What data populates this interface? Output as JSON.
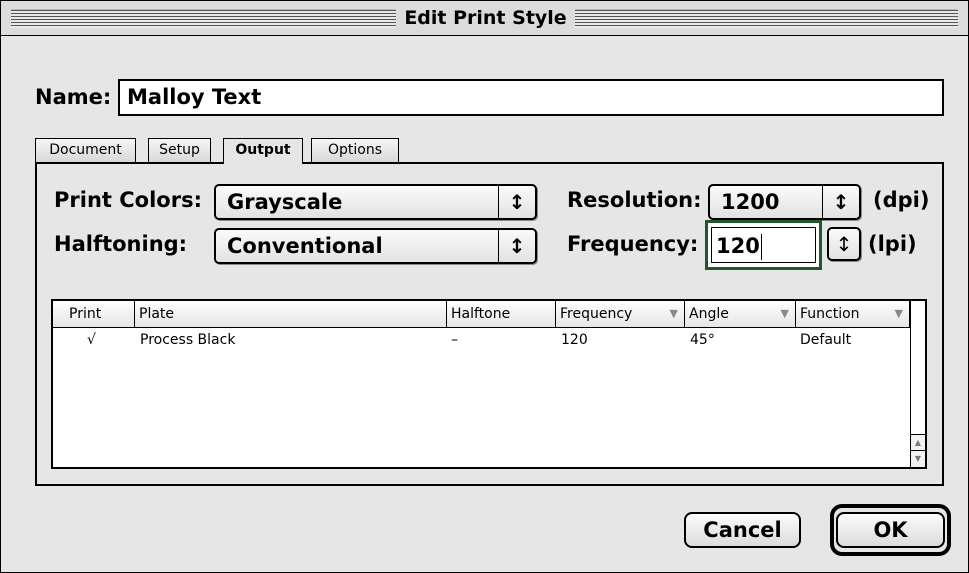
{
  "window": {
    "title": "Edit Print Style"
  },
  "name": {
    "label": "Name:",
    "value": "Malloy Text"
  },
  "tabs": [
    {
      "label": "Document",
      "active": false
    },
    {
      "label": "Setup",
      "active": false
    },
    {
      "label": "Output",
      "active": true
    },
    {
      "label": "Options",
      "active": false
    }
  ],
  "output": {
    "print_colors": {
      "label": "Print Colors:",
      "value": "Grayscale"
    },
    "halftoning": {
      "label": "Halftoning:",
      "value": "Conventional"
    },
    "resolution": {
      "label": "Resolution:",
      "value": "1200",
      "unit": "(dpi)"
    },
    "frequency": {
      "label": "Frequency:",
      "value": "120",
      "unit": "(lpi)"
    }
  },
  "table": {
    "columns": [
      "Print",
      "Plate",
      "Halftone",
      "Frequency",
      "Angle",
      "Function"
    ],
    "rows": [
      {
        "print": "√",
        "plate": "Process Black",
        "halftone": "–",
        "frequency": "120",
        "angle": "45°",
        "function": "Default"
      }
    ]
  },
  "buttons": {
    "cancel": "Cancel",
    "ok": "OK"
  },
  "icons": {
    "updown": "updown-arrows-icon",
    "sort": "sort-down-icon",
    "scroll_up": "scroll-up-arrow-icon",
    "scroll_down": "scroll-down-arrow-icon"
  }
}
